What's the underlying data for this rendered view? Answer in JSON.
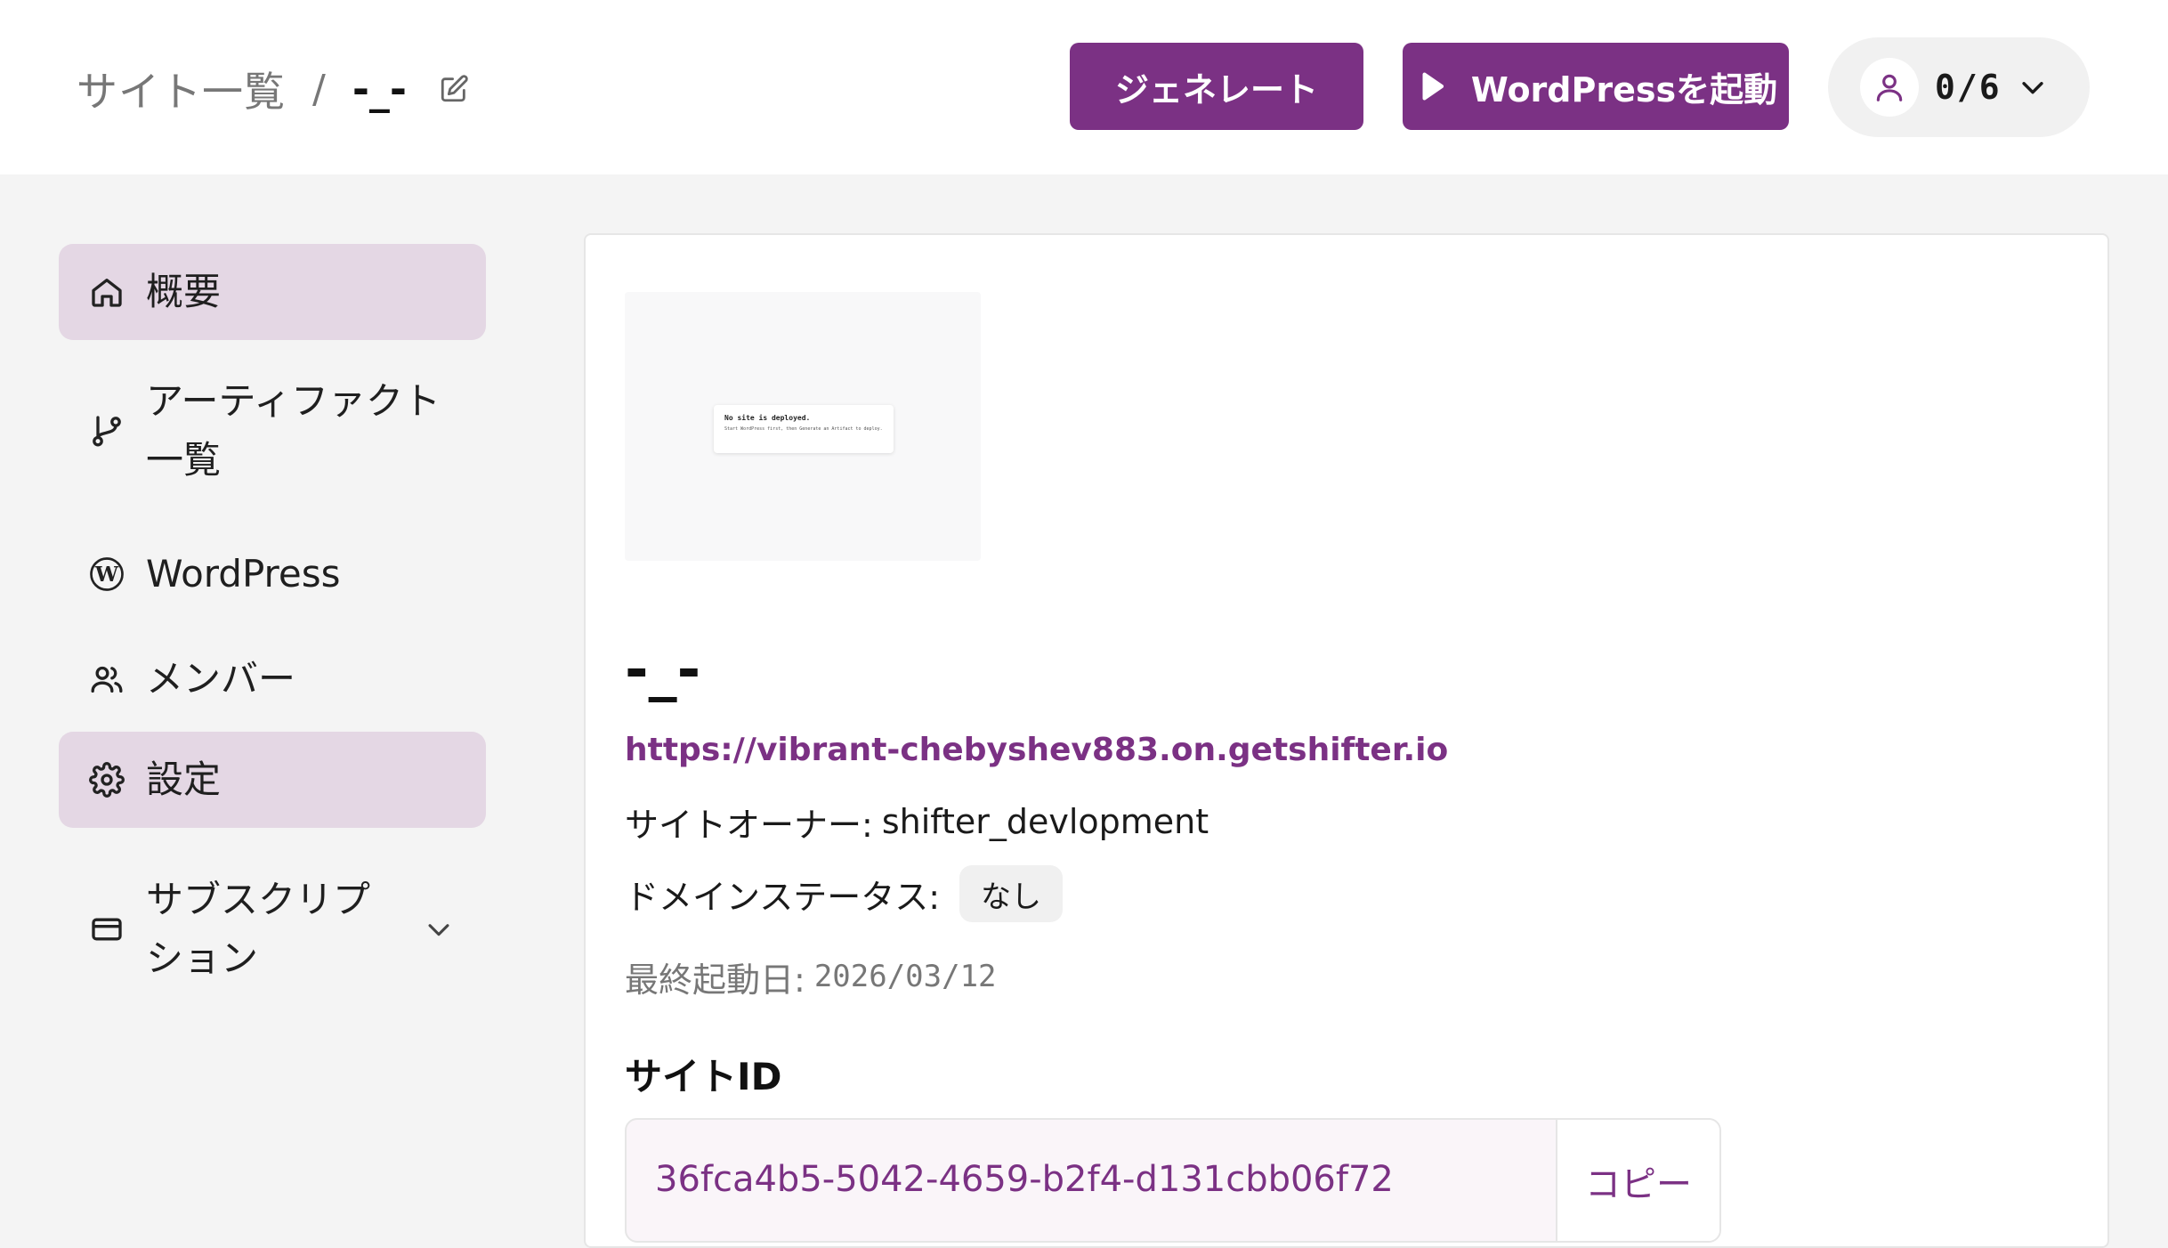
{
  "header": {
    "breadcrumb_root": "サイト一覧",
    "breadcrumb_separator": "/",
    "breadcrumb_current": "-_-",
    "generate_label": "ジェネレート",
    "launch_label": "WordPressを起動",
    "user_count": "0/6"
  },
  "sidebar": {
    "items": [
      {
        "label": "概要",
        "icon": "home-icon",
        "active": true
      },
      {
        "label": "アーティファクト一覧",
        "icon": "git-branch-icon",
        "active": false
      },
      {
        "label": "WordPress",
        "icon": "wordpress-icon",
        "active": false
      },
      {
        "label": "メンバー",
        "icon": "users-icon",
        "active": false
      },
      {
        "label": "設定",
        "icon": "gear-icon",
        "active": true
      },
      {
        "label": "サブスクリプション",
        "icon": "credit-card-icon",
        "active": false
      }
    ]
  },
  "main": {
    "thumbnail": {
      "title": "No site is deployed.",
      "text": "Start WordPress first, then Generate an Artifact to deploy."
    },
    "site_name": "-_-",
    "site_url": "https://vibrant-chebyshev883.on.getshifter.io",
    "owner_label": "サイトオーナー:",
    "owner_value": "shifter_devlopment",
    "domain_status_label": "ドメインステータス:",
    "domain_status_value": "なし",
    "last_launch_label": "最終起動日:",
    "last_launch_value": "2026/03/12",
    "site_id_title": "サイトID",
    "site_id_value": "36fca4b5-5042-4659-b2f4-d131cbb06f72",
    "copy_label": "コピー"
  },
  "colors": {
    "accent": "#7b3184",
    "active_nav_bg": "#e4d7e4",
    "page_bg": "#f4f4f4"
  }
}
